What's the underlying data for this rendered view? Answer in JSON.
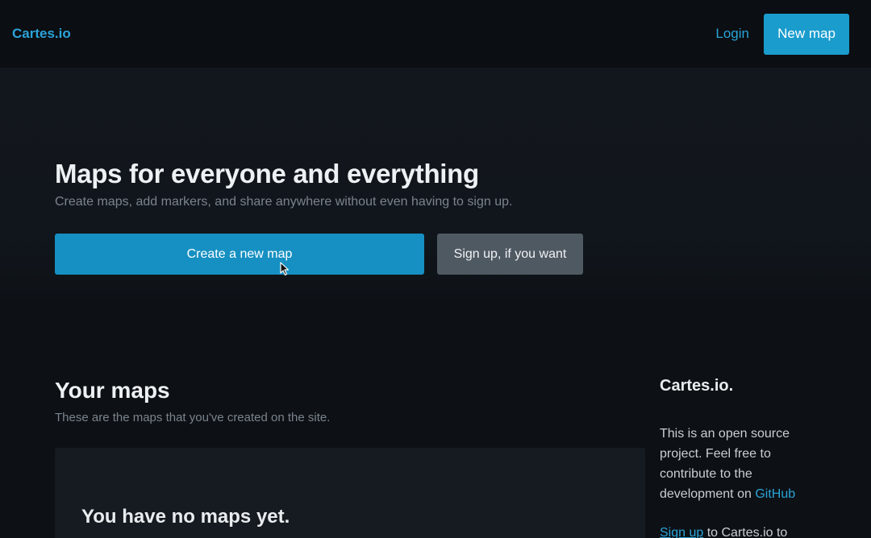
{
  "navbar": {
    "brand": "Cartes.io",
    "login": "Login",
    "new_map": "New map"
  },
  "hero": {
    "title": "Maps for everyone and everything",
    "subtitle": "Create maps, add markers, and share anywhere without even having to sign up.",
    "create_button": "Create a new map",
    "signup_button": "Sign up, if you want"
  },
  "your_maps": {
    "title": "Your maps",
    "subtitle": "These are the maps that you've created on the site.",
    "empty_message": "You have no maps yet."
  },
  "sidebar": {
    "title": "Cartes.io.",
    "about_text": "This is an open source project. Feel free to contribute to the development on ",
    "github_link": "GitHub",
    "signup_link": "Sign up",
    "signup_text": " to Cartes.io to"
  },
  "colors": {
    "accent": "#1a9ccd",
    "link": "#2ba3d8",
    "background": "#0d1115",
    "secondary_button": "#4f5962"
  }
}
